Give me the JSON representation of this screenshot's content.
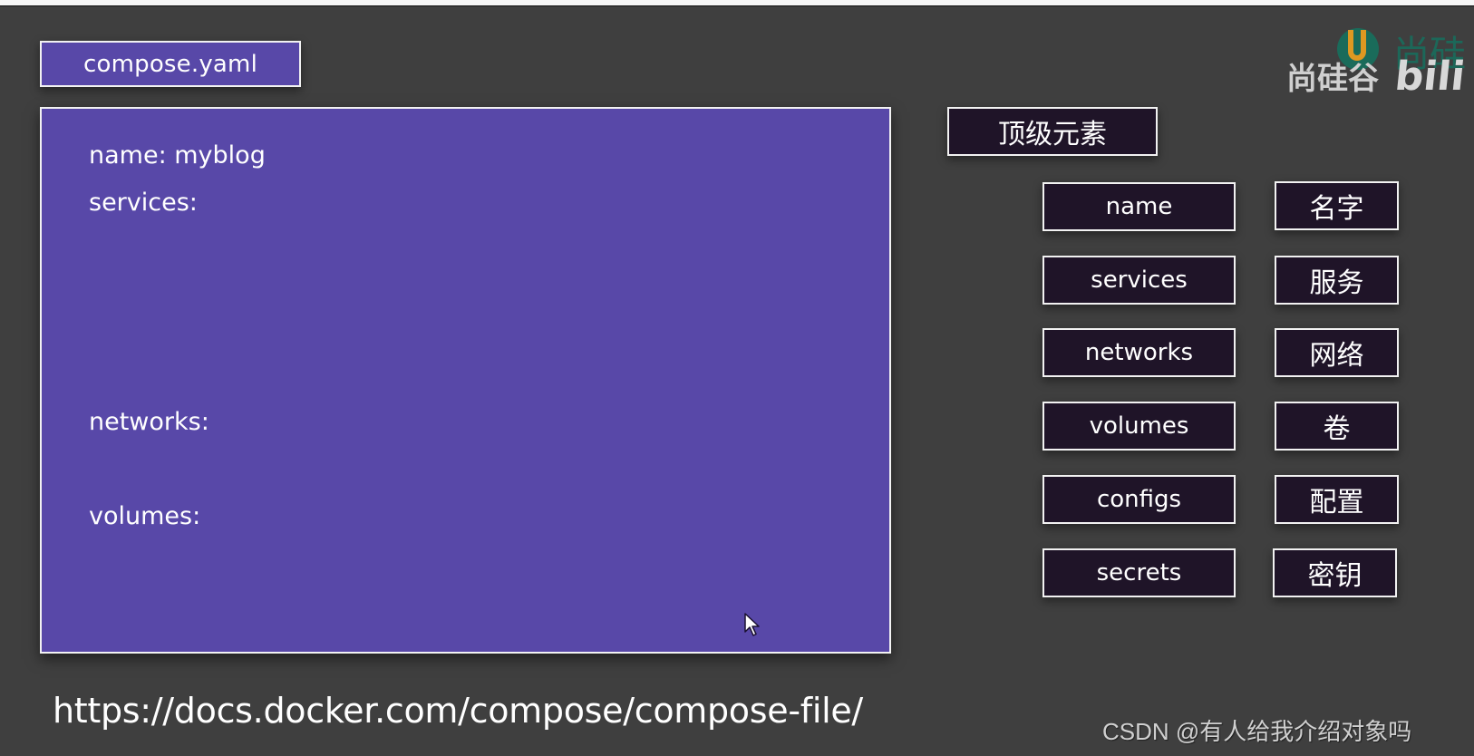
{
  "slide": {
    "file_label": "compose.yaml",
    "yaml_lines": {
      "name": "name: myblog",
      "services": "services:",
      "networks": "networks:",
      "volumes": "volumes:"
    },
    "top_level_heading": "顶级元素",
    "elements": [
      {
        "en": "name",
        "zh": "名字"
      },
      {
        "en": "services",
        "zh": "服务"
      },
      {
        "en": "networks",
        "zh": "网络"
      },
      {
        "en": "volumes",
        "zh": "卷"
      },
      {
        "en": "configs",
        "zh": "配置"
      },
      {
        "en": "secrets",
        "zh": "密钥"
      }
    ],
    "doc_url": "https://docs.docker.com/compose/compose-file/"
  },
  "branding": {
    "logo_text": "尚硅谷",
    "logo_brand": "尚硅",
    "logo_bili": "bili",
    "watermark": "CSDN @有人给我介绍对象吗"
  },
  "colors": {
    "background": "#3f3f3f",
    "panel": "#5848a8",
    "element_box": "#1f1428",
    "border": "#f2f2f2"
  },
  "icons": {
    "cursor": "mouse-pointer-icon",
    "logo": "atguigu-logo-icon"
  }
}
